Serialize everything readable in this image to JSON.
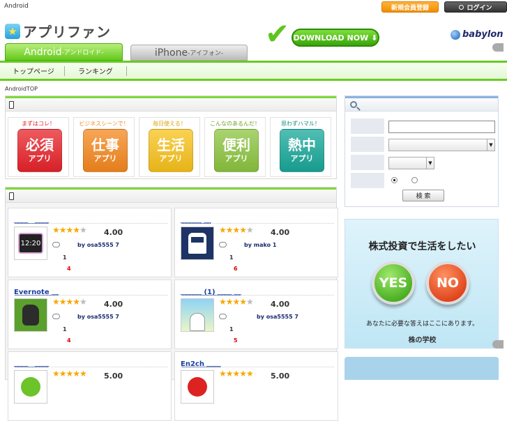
{
  "topbar": {
    "site_label": "Android",
    "register_label": "新規会員登録",
    "login_label": "ログイン"
  },
  "header": {
    "logo_text": "アプリファン",
    "download_label": "DOWNLOAD NOW",
    "babylon_label": "babylon"
  },
  "tabs": {
    "android": {
      "main": "Android",
      "sub": " -アンドロイド-"
    },
    "iphone": {
      "main": "iPhone",
      "sub": " -アイフォン-"
    }
  },
  "nav": {
    "items": [
      {
        "label": "トップページ"
      },
      {
        "label": "ランキング"
      }
    ]
  },
  "breadcrumb": "AndroidTOP",
  "categories": [
    {
      "tagline": "まずはコレ！",
      "name": "必須",
      "sub": "アプリ",
      "color": "#e8232a"
    },
    {
      "tagline": "ビジネスシーンで！",
      "name": "仕事",
      "sub": "アプリ",
      "color": "#f6881e"
    },
    {
      "tagline": "毎日使える！",
      "name": "生活",
      "sub": "アプリ",
      "color": "#f9c21a"
    },
    {
      "tagline": "こんなのあるんだ！",
      "name": "便利",
      "sub": "アプリ",
      "color": "#8cc53f"
    },
    {
      "tagline": "思わずハマル！",
      "name": "熱中",
      "sub": "アプリ",
      "color": "#18a89a"
    }
  ],
  "apps": [
    {
      "title": "＿＿　＿＿",
      "rating": 4,
      "score": "4.00",
      "by": "by osa5555 7",
      "n1": "1",
      "n2": "4",
      "icon": "clock-icon"
    },
    {
      "title": "＿＿＿ ＿",
      "rating": 4,
      "score": "4.00",
      "by": "by mako 1",
      "n1": "1",
      "n2": "6",
      "icon": "train-icon"
    },
    {
      "title": "Evernote ＿",
      "rating": 4,
      "score": "4.00",
      "by": "by osa5555 7",
      "n1": "1",
      "n2": "4",
      "icon": "evernote-icon"
    },
    {
      "title": "＿＿＿ (1) ＿＿ ＿",
      "rating": 4,
      "score": "4.00",
      "by": "by osa5555 7",
      "n1": "1",
      "n2": "5",
      "icon": "cartoon-icon"
    },
    {
      "title": "＿＿　＿＿",
      "rating": 5,
      "score": "5.00",
      "icon": "bird-icon"
    },
    {
      "title": "En2ch ＿＿",
      "rating": 5,
      "score": "5.00",
      "icon": "en2ch-icon"
    }
  ],
  "search": {
    "button_label": "検 索"
  },
  "ad": {
    "title": "株式投資で生活をしたい",
    "yes": "YES",
    "no": "NO",
    "subtitle": "あなたに必要な答えはここにあります。",
    "logo": "株の学校"
  }
}
